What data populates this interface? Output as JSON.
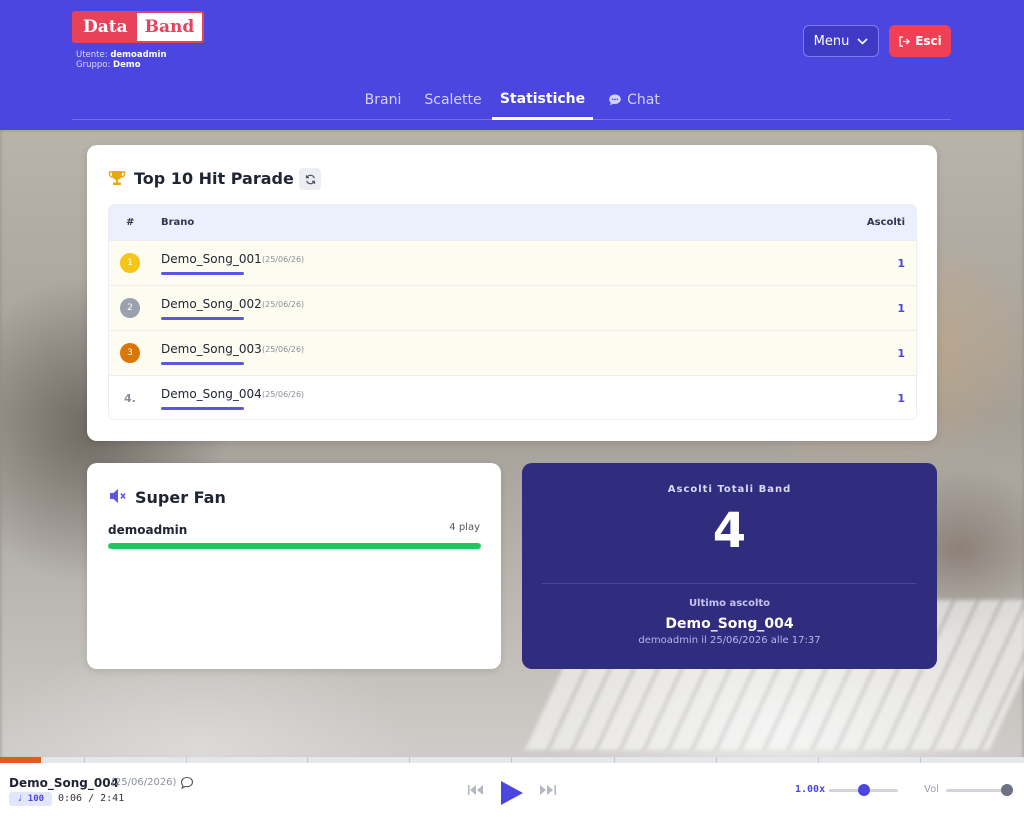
{
  "header": {
    "logo_part1": "Data",
    "logo_part2": "Band",
    "user_label": "Utente:",
    "user_value": "demoadmin",
    "group_label": "Gruppo:",
    "group_value": "Demo",
    "menu_label": "Menu",
    "exit_label": "Esci"
  },
  "nav": {
    "tabs": [
      {
        "label": "Brani"
      },
      {
        "label": "Scalette"
      },
      {
        "label": "Statistiche",
        "active": true
      },
      {
        "label": "Chat"
      }
    ]
  },
  "hitparade": {
    "title": "Top 10 Hit Parade",
    "columns": {
      "rank": "#",
      "song": "Brano",
      "plays": "Ascolti"
    },
    "rows": [
      {
        "rank": "1",
        "song": "Demo_Song_001",
        "date": "(25/06/26)",
        "plays": "1",
        "badge_color": "#f5c518"
      },
      {
        "rank": "2",
        "song": "Demo_Song_002",
        "date": "(25/06/26)",
        "plays": "1",
        "badge_color": "#9aa0ad"
      },
      {
        "rank": "3",
        "song": "Demo_Song_003",
        "date": "(25/06/26)",
        "plays": "1",
        "badge_color": "#d97706"
      },
      {
        "rank": "4.",
        "song": "Demo_Song_004",
        "date": "(25/06/26)",
        "plays": "1"
      }
    ]
  },
  "superfan": {
    "title": "Super Fan",
    "user": "demoadmin",
    "plays": "4 play",
    "fill_fraction": 1.0
  },
  "stats": {
    "total_label": "Ascolti Totali Band",
    "total_value": "4",
    "last_label": "Ultimo ascolto",
    "last_song": "Demo_Song_004",
    "last_detail": "demoadmin il 25/06/2026 alle 17:37"
  },
  "player": {
    "title": "Demo_Song_004",
    "date": "(25/06/2026)",
    "bpm": "♩ 100",
    "time": "0:06 / 2:41",
    "progress_fraction": 0.04,
    "speed": "1.00x",
    "speed_fraction": 0.5,
    "volume_label": "Vol",
    "volume_fraction": 1.0
  },
  "colors": {
    "brand": "#4c46e0",
    "danger": "#ef4056",
    "fan_bar": "#22c55e",
    "progress": "#e25a1c"
  }
}
